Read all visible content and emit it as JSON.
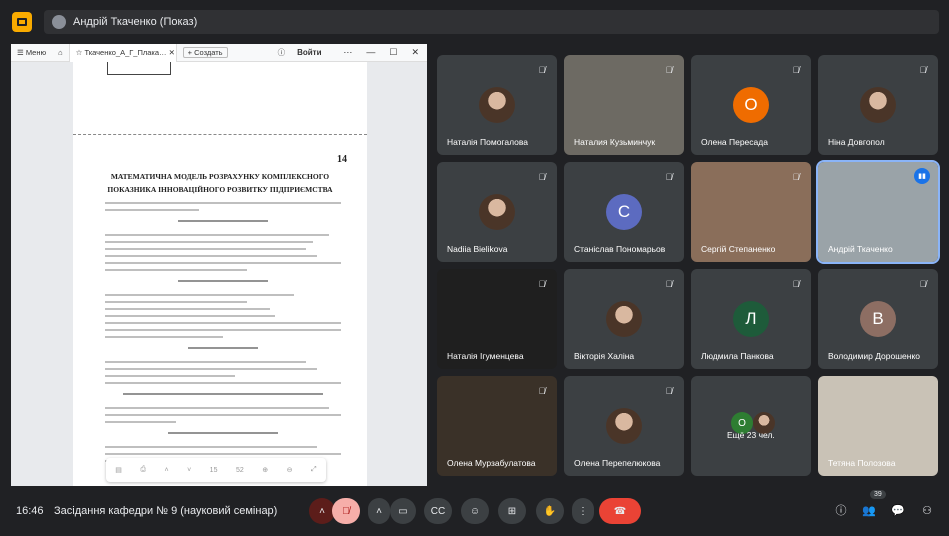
{
  "header": {
    "presenter_label": "Андрій Ткаченко (Показ)"
  },
  "browser": {
    "menu_label": "Меню",
    "tab_label": "Ткаченко_А_Г_Плака…",
    "create_label": "+ Создать",
    "login_label": "Войти"
  },
  "document": {
    "page_number": "14",
    "title": "МАТЕМАТИЧНА МОДЕЛЬ РОЗРАХУНКУ КОМПЛЕКСНОГО ПОКАЗНИКА ІННОВАЦІЙНОГО РОЗВИТКУ ПІДПРИЄМСТВА",
    "toolbar_page": "15",
    "toolbar_total": "52"
  },
  "participants": [
    {
      "name": "Наталія Помогалова",
      "type": "photo"
    },
    {
      "name": "Наталия Кузьминчук",
      "type": "video"
    },
    {
      "name": "Олена Пересада",
      "type": "letter",
      "letter": "О",
      "color": "#ef6c00"
    },
    {
      "name": "Ніна Довгопол",
      "type": "photo"
    },
    {
      "name": "Nadiia Bielikova",
      "type": "photo"
    },
    {
      "name": "Станіслав Пономарьов",
      "type": "letter",
      "letter": "С",
      "color": "#5c6bc0"
    },
    {
      "name": "Сергій Степаненко",
      "type": "video"
    },
    {
      "name": "Андрій Ткаченко",
      "type": "video",
      "speaking": true
    },
    {
      "name": "Наталія Ігуменцева",
      "type": "dark"
    },
    {
      "name": "Вікторія Халіна",
      "type": "photo"
    },
    {
      "name": "Людмила Панкова",
      "type": "letter",
      "letter": "Л",
      "color": "#1e5b3a"
    },
    {
      "name": "Володимир Дорошенко",
      "type": "letter",
      "letter": "В",
      "color": "#8d6e63"
    },
    {
      "name": "Олена Мурзабулатова",
      "type": "video"
    },
    {
      "name": "Олена Перепелюкова",
      "type": "photo"
    },
    {
      "name": "Ещё 23 чел.",
      "type": "more",
      "letter": "О"
    },
    {
      "name": "Тетяна Полозова",
      "type": "video"
    }
  ],
  "bottombar": {
    "time": "16:46",
    "meeting_title": "Засідання кафедри № 9 (науковий семінар)",
    "participants_count": "39"
  },
  "icons": {
    "mic_off": "mic-off-icon",
    "camera": "camera-icon",
    "captions": "captions-icon",
    "emoji": "emoji-icon",
    "present": "present-icon",
    "raise_hand": "raise-hand-icon",
    "more": "more-icon",
    "end_call": "end-call-icon",
    "info": "info-icon",
    "people": "people-icon",
    "chat": "chat-icon",
    "activities": "activities-icon"
  }
}
